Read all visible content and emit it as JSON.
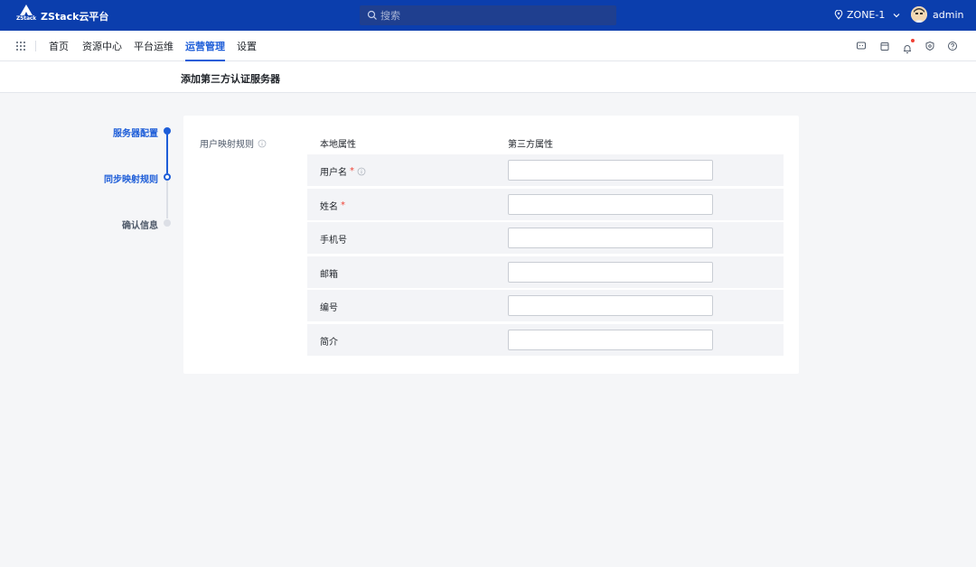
{
  "app": {
    "logo_text": "ZStack",
    "brand": "ZStack云平台",
    "search_placeholder": "搜索",
    "zone": "ZONE-1",
    "user": "admin"
  },
  "nav": {
    "items": [
      "首页",
      "资源中心",
      "平台运维",
      "运营管理",
      "设置"
    ],
    "active_index": 3,
    "right_icons": [
      "chat-icon",
      "cube-icon",
      "bell-icon",
      "shield-icon",
      "help-icon"
    ]
  },
  "page": {
    "title": "添加第三方认证服务器"
  },
  "steps": [
    {
      "label": "服务器配置",
      "state": "done"
    },
    {
      "label": "同步映射规则",
      "state": "current"
    },
    {
      "label": "确认信息",
      "state": "pending"
    }
  ],
  "form": {
    "section_label": "用户映射规则",
    "col_local": "本地属性",
    "col_third": "第三方属性",
    "rows": [
      {
        "label": "用户名",
        "required": "*",
        "value": ""
      },
      {
        "label": "姓名",
        "required": "*",
        "value": ""
      },
      {
        "label": "手机号",
        "value": ""
      },
      {
        "label": "邮箱",
        "value": ""
      },
      {
        "label": "编号",
        "value": ""
      },
      {
        "label": "简介",
        "value": ""
      }
    ]
  },
  "colors": {
    "topbar": "#0b3ead",
    "accent": "#1d5dd8",
    "required": "#f04134"
  }
}
